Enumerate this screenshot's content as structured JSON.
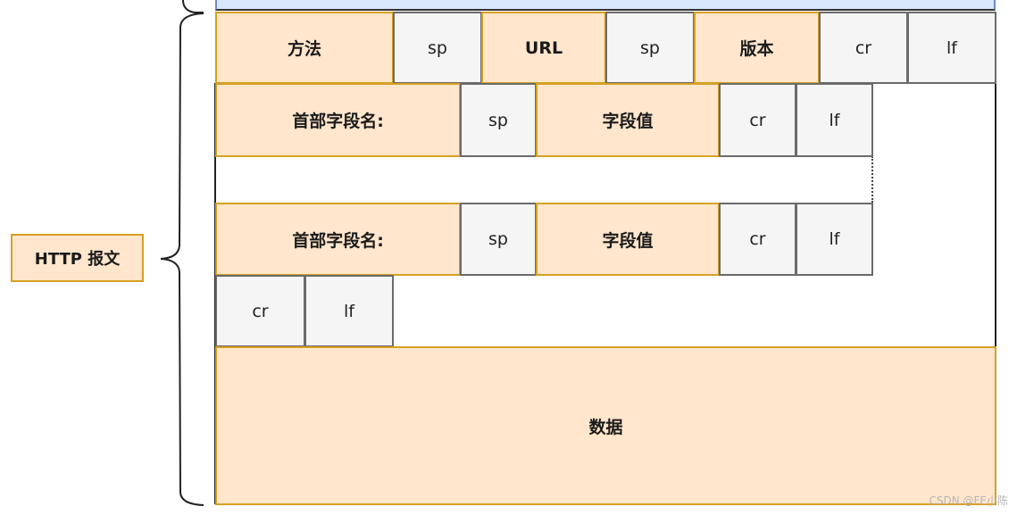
{
  "diagram": {
    "title_label": "HTTP 报文",
    "request_line": {
      "method": "方法",
      "sp1": "sp",
      "url": "URL",
      "sp2": "sp",
      "version": "版本",
      "cr": "cr",
      "lf": "lf"
    },
    "header_lines": [
      {
        "name": "首部字段名:",
        "sp": "sp",
        "value": "字段值",
        "cr": "cr",
        "lf": "lf"
      },
      {
        "name": "首部字段名:",
        "sp": "sp",
        "value": "字段值",
        "cr": "cr",
        "lf": "lf"
      }
    ],
    "blank_line": {
      "cr": "cr",
      "lf": "lf"
    },
    "body": "数据",
    "colors": {
      "field_fill": "#ffe6cc",
      "field_border": "#d6a022",
      "delimiter_fill": "#f5f5f5",
      "delimiter_border": "#6b6b6b",
      "top_strip_fill": "#dae8fc"
    }
  },
  "watermark": "CSDN @FE小陈"
}
